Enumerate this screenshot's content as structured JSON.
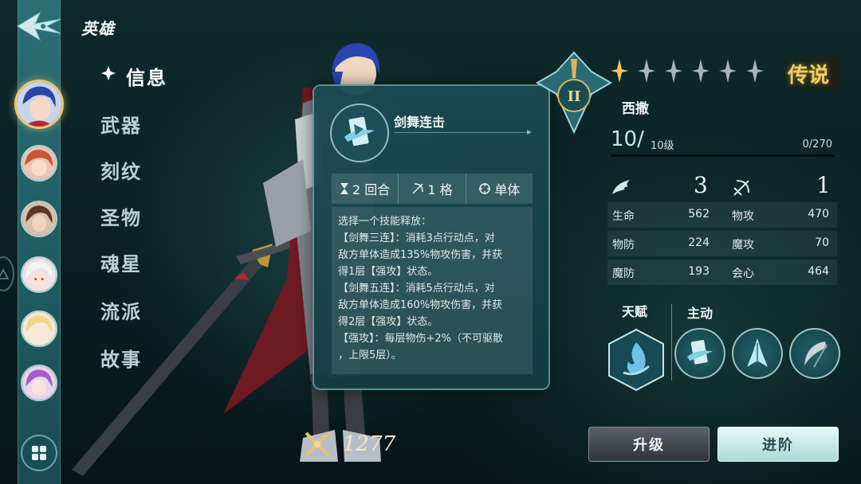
{
  "header": {
    "title": "英雄",
    "back_icon": "winged-arrow-back-icon"
  },
  "sidebar": {
    "avatars": [
      {
        "name": "hero-avatar-1",
        "active": true
      },
      {
        "name": "hero-avatar-2",
        "active": false
      },
      {
        "name": "hero-avatar-3",
        "active": false
      },
      {
        "name": "hero-avatar-4",
        "active": false
      },
      {
        "name": "hero-avatar-5",
        "active": false
      },
      {
        "name": "hero-avatar-6",
        "active": false
      }
    ],
    "grid_icon": "grid-icon"
  },
  "menu": {
    "items": [
      "信息",
      "武器",
      "刻纹",
      "圣物",
      "魂星",
      "流派",
      "故事"
    ],
    "active_index": 0
  },
  "skill_popup": {
    "name": "剑舞连击",
    "stats": {
      "turns": "2 回合",
      "range": "1 格",
      "target": "单体"
    },
    "description": [
      "选择一个技能释放：",
      "【剑舞三连】：消耗3点行动点，对",
      "敌方单体造成135%物攻伤害，并获",
      "得1层【强攻】状态。",
      "【剑舞五连】：消耗5点行动点，对",
      "敌方单体造成160%物攻伤害，并获",
      "得2层【强攻】状态。",
      "【强攻】：每层物伤+2%（不可驱散",
      "，上限5层）。"
    ]
  },
  "hero": {
    "rank": "II",
    "stars_filled": 1,
    "stars_total": 6,
    "rarity": "传说",
    "name": "西撒",
    "level": "10/",
    "level_max": "10级",
    "exp": "0/270",
    "exp_fraction": 0,
    "movement": "3",
    "attack_range": "1",
    "attributes": {
      "hp_label": "生命",
      "hp": "562",
      "patk_label": "物攻",
      "patk": "470",
      "pdef_label": "物防",
      "pdef": "224",
      "matk_label": "魔攻",
      "matk": "70",
      "mdef_label": "魔防",
      "mdef": "193",
      "crit_label": "会心",
      "crit": "464"
    },
    "talent_label": "天赋",
    "active_label": "主动",
    "power": "1277"
  },
  "buttons": {
    "upgrade": "升级",
    "advance": "进阶"
  },
  "colors": {
    "accent_gold": "#f4cc5d",
    "panel_teal": "#1a4a52",
    "rail": "#2a6f73"
  }
}
